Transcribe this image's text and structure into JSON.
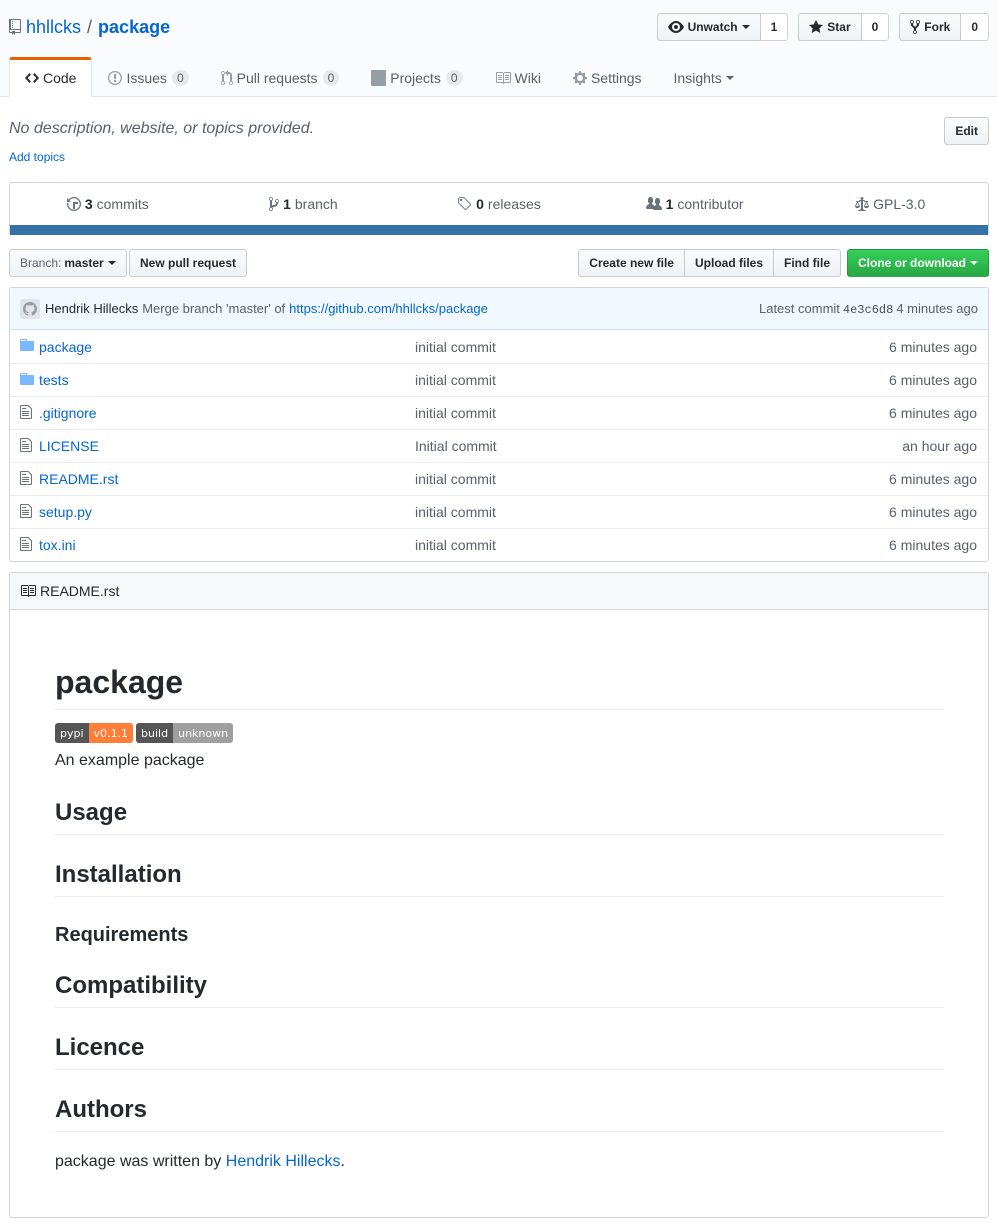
{
  "repo": {
    "owner": "hhllcks",
    "separator": "/",
    "name": "package"
  },
  "actions": {
    "watch_label": "Unwatch",
    "watch_count": "1",
    "star_label": "Star",
    "star_count": "0",
    "fork_label": "Fork",
    "fork_count": "0"
  },
  "nav": {
    "code": "Code",
    "issues": "Issues",
    "issues_count": "0",
    "pulls": "Pull requests",
    "pulls_count": "0",
    "projects": "Projects",
    "projects_count": "0",
    "wiki": "Wiki",
    "settings": "Settings",
    "insights": "Insights"
  },
  "description": "No description, website, or topics provided.",
  "add_topics": "Add topics",
  "edit_label": "Edit",
  "summary": {
    "commits_num": "3",
    "commits_label": "commits",
    "branch_num": "1",
    "branch_label": "branch",
    "releases_num": "0",
    "releases_label": "releases",
    "contributor_num": "1",
    "contributor_label": "contributor",
    "license": "GPL-3.0",
    "language_color": "#3572A5"
  },
  "branch": {
    "label": "Branch:",
    "value": "master"
  },
  "new_pr_label": "New pull request",
  "file_actions": {
    "create": "Create new file",
    "upload": "Upload files",
    "find": "Find file",
    "clone": "Clone or download"
  },
  "commit": {
    "author": "Hendrik Hillecks",
    "message": "Merge branch 'master' of",
    "link": "https://github.com/hhllcks/package",
    "latest_label": "Latest commit",
    "sha": "4e3c6d8",
    "age": "4 minutes ago"
  },
  "files": [
    {
      "type": "folder",
      "name": "package",
      "message": "initial commit",
      "age": "6 minutes ago"
    },
    {
      "type": "folder",
      "name": "tests",
      "message": "initial commit",
      "age": "6 minutes ago"
    },
    {
      "type": "file",
      "name": ".gitignore",
      "message": "initial commit",
      "age": "6 minutes ago"
    },
    {
      "type": "file",
      "name": "LICENSE",
      "message": "Initial commit",
      "age": "an hour ago"
    },
    {
      "type": "file",
      "name": "README.rst",
      "message": "initial commit",
      "age": "6 minutes ago"
    },
    {
      "type": "file",
      "name": "setup.py",
      "message": "initial commit",
      "age": "6 minutes ago"
    },
    {
      "type": "file",
      "name": "tox.ini",
      "message": "initial commit",
      "age": "6 minutes ago"
    }
  ],
  "readme": {
    "filename": "README.rst",
    "title": "package",
    "badges": [
      {
        "left": "pypi",
        "right": "v0.1.1",
        "color": "#fe7d37"
      },
      {
        "left": "build",
        "right": "unknown",
        "color": "#9f9f9f"
      }
    ],
    "intro": "An example package",
    "usage": "Usage",
    "installation": "Installation",
    "requirements": "Requirements",
    "compatibility": "Compatibility",
    "licence": "Licence",
    "authors": "Authors",
    "authors_text": "package was written by",
    "authors_link": "Hendrik Hillecks",
    "authors_end": "."
  }
}
